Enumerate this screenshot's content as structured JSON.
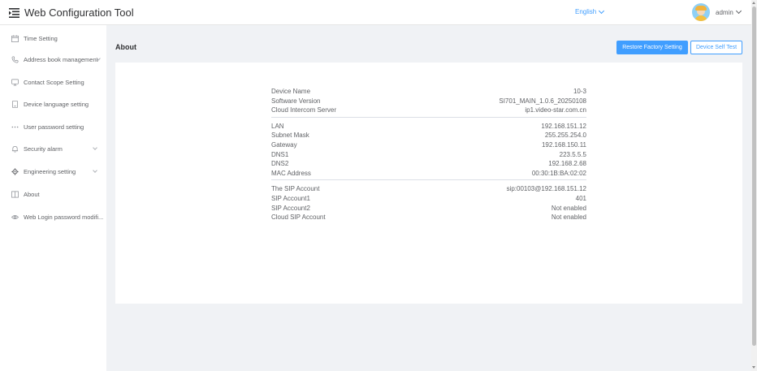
{
  "header": {
    "app_title": "Web Configuration Tool",
    "language": "English",
    "user": "admin"
  },
  "sidebar": {
    "items": [
      {
        "label": "Time Setting",
        "icon": "calendar-icon",
        "has_submenu": false
      },
      {
        "label": "Address book management",
        "icon": "phone-icon",
        "has_submenu": true
      },
      {
        "label": "Contact Scope Setting",
        "icon": "monitor-icon",
        "has_submenu": false
      },
      {
        "label": "Device language setting",
        "icon": "document-icon",
        "has_submenu": false
      },
      {
        "label": "User password setting",
        "icon": "dots-icon",
        "has_submenu": false
      },
      {
        "label": "Security alarm",
        "icon": "bell-icon",
        "has_submenu": true
      },
      {
        "label": "Engineering setting",
        "icon": "gear-icon",
        "has_submenu": true
      },
      {
        "label": "About",
        "icon": "book-icon",
        "has_submenu": false
      },
      {
        "label": "Web Login password modifi...",
        "icon": "eye-icon",
        "has_submenu": false
      }
    ]
  },
  "main": {
    "title": "About",
    "restore_button": "Restore Factory Setting",
    "self_test_button": "Device Self Test",
    "groups": [
      [
        {
          "label": "Device Name",
          "value": "10-3"
        },
        {
          "label": "Software Version",
          "value": "SI701_MAIN_1.0.6_20250108"
        },
        {
          "label": "Cloud Intercom Server",
          "value": "ip1.video-star.com.cn"
        }
      ],
      [
        {
          "label": "LAN",
          "value": "192.168.151.12"
        },
        {
          "label": "Subnet Mask",
          "value": "255.255.254.0"
        },
        {
          "label": "Gateway",
          "value": "192.168.150.11"
        },
        {
          "label": "DNS1",
          "value": "223.5.5.5"
        },
        {
          "label": "DNS2",
          "value": "192.168.2.68"
        },
        {
          "label": "MAC Address",
          "value": "00:30:1B:BA:02:02"
        }
      ],
      [
        {
          "label": "The SIP Account",
          "value": "sip:00103@192.168.151.12"
        },
        {
          "label": "SIP Account1",
          "value": "401"
        },
        {
          "label": "SIP Account2",
          "value": "Not enabled"
        },
        {
          "label": "Cloud SIP Account",
          "value": "Not enabled"
        }
      ]
    ]
  },
  "colors": {
    "primary": "#409eff",
    "background": "#f0f2f5",
    "text": "#606266"
  }
}
